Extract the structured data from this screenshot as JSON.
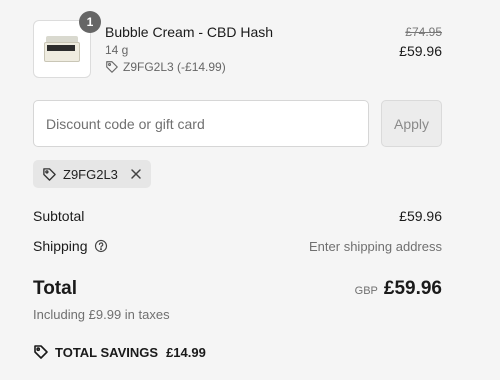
{
  "line_item": {
    "quantity": "1",
    "title": "Bubble Cream - CBD Hash",
    "variant": "14 g",
    "discount": "Z9FG2L3 (-£14.99)",
    "compare_price": "£74.95",
    "price": "£59.96",
    "thumbnail_icon": "product-jar-icon"
  },
  "discount_form": {
    "placeholder": "Discount code or gift card",
    "apply_label": "Apply"
  },
  "applied_code": {
    "code": "Z9FG2L3",
    "tag_icon": "tag-icon",
    "remove_icon": "close-icon"
  },
  "summary": {
    "subtotal_label": "Subtotal",
    "subtotal_value": "£59.96",
    "shipping_label": "Shipping",
    "shipping_value": "Enter shipping address",
    "total_label": "Total",
    "currency": "GBP",
    "total_value": "£59.96",
    "taxes_note": "Including £9.99 in taxes"
  },
  "savings": {
    "label": "TOTAL SAVINGS",
    "amount": "£14.99"
  },
  "colors": {
    "background": "#f5f5f5",
    "badge": "#666666",
    "muted_text": "#707070"
  }
}
